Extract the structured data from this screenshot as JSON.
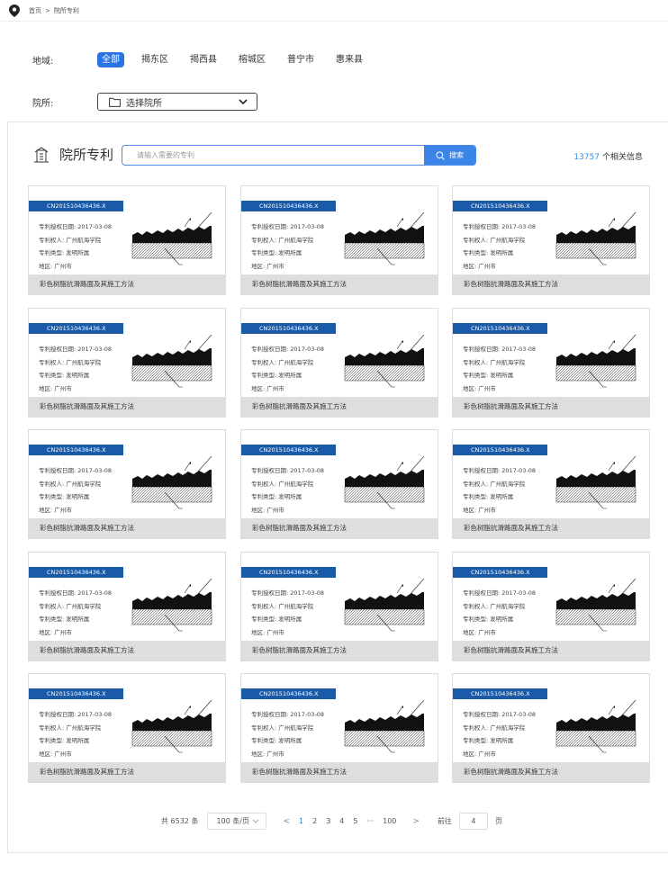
{
  "breadcrumb": {
    "home": "首页",
    "separator": ">",
    "current": "院所专利"
  },
  "filters": {
    "region_label": "地域:",
    "regions": [
      "全部",
      "揭东区",
      "揭西县",
      "榕城区",
      "普宁市",
      "惠来县"
    ],
    "active_region": "全部",
    "institution_label": "院所:",
    "institution_placeholder": "选择院所"
  },
  "panel": {
    "title": "院所专利",
    "search_placeholder": "请输入需要的专利",
    "search_button": "搜索",
    "result_count": "13757",
    "result_suffix": "个相关信息"
  },
  "field_labels": {
    "date": "专利授权日期:",
    "owner": "专利权人:",
    "type": "专利类型:",
    "region": "地区:"
  },
  "patents": [
    {
      "number": "CN201510436436.X",
      "date": "2017-03-08",
      "owner": "广州航海学院",
      "type": "发明所属",
      "region": "广州市",
      "title": "彩色树脂抗滑路面及其施工方法"
    },
    {
      "number": "CN201510436436.X",
      "date": "2017-03-08",
      "owner": "广州航海学院",
      "type": "发明所属",
      "region": "广州市",
      "title": "彩色树脂抗滑路面及其施工方法"
    },
    {
      "number": "CN201510436436.X",
      "date": "2017-03-08",
      "owner": "广州航海学院",
      "type": "发明所属",
      "region": "广州市",
      "title": "彩色树脂抗滑路面及其施工方法"
    },
    {
      "number": "CN201510436436.X",
      "date": "2017-03-08",
      "owner": "广州航海学院",
      "type": "发明所属",
      "region": "广州市",
      "title": "彩色树脂抗滑路面及其施工方法"
    },
    {
      "number": "CN201510436436.X",
      "date": "2017-03-08",
      "owner": "广州航海学院",
      "type": "发明所属",
      "region": "广州市",
      "title": "彩色树脂抗滑路面及其施工方法"
    },
    {
      "number": "CN201510436436.X",
      "date": "2017-03-08",
      "owner": "广州航海学院",
      "type": "发明所属",
      "region": "广州市",
      "title": "彩色树脂抗滑路面及其施工方法"
    },
    {
      "number": "CN201510436436.X",
      "date": "2017-03-08",
      "owner": "广州航海学院",
      "type": "发明所属",
      "region": "广州市",
      "title": "彩色树脂抗滑路面及其施工方法"
    },
    {
      "number": "CN201510436436.X",
      "date": "2017-03-08",
      "owner": "广州航海学院",
      "type": "发明所属",
      "region": "广州市",
      "title": "彩色树脂抗滑路面及其施工方法"
    },
    {
      "number": "CN201510436436.X",
      "date": "2017-03-08",
      "owner": "广州航海学院",
      "type": "发明所属",
      "region": "广州市",
      "title": "彩色树脂抗滑路面及其施工方法"
    },
    {
      "number": "CN201510436436.X",
      "date": "2017-03-08",
      "owner": "广州航海学院",
      "type": "发明所属",
      "region": "广州市",
      "title": "彩色树脂抗滑路面及其施工方法"
    },
    {
      "number": "CN201510436436.X",
      "date": "2017-03-08",
      "owner": "广州航海学院",
      "type": "发明所属",
      "region": "广州市",
      "title": "彩色树脂抗滑路面及其施工方法"
    },
    {
      "number": "CN201510436436.X",
      "date": "2017-03-08",
      "owner": "广州航海学院",
      "type": "发明所属",
      "region": "广州市",
      "title": "彩色树脂抗滑路面及其施工方法"
    },
    {
      "number": "CN201510436436.X",
      "date": "2017-03-08",
      "owner": "广州航海学院",
      "type": "发明所属",
      "region": "广州市",
      "title": "彩色树脂抗滑路面及其施工方法"
    },
    {
      "number": "CN201510436436.X",
      "date": "2017-03-08",
      "owner": "广州航海学院",
      "type": "发明所属",
      "region": "广州市",
      "title": "彩色树脂抗滑路面及其施工方法"
    },
    {
      "number": "CN201510436436.X",
      "date": "2017-03-08",
      "owner": "广州航海学院",
      "type": "发明所属",
      "region": "广州市",
      "title": "彩色树脂抗滑路面及其施工方法"
    }
  ],
  "pagination": {
    "total_text": "共 6532 条",
    "page_size": "100 条/页",
    "prev": "<",
    "pages": [
      "1",
      "2",
      "3",
      "4",
      "5",
      "···",
      "100"
    ],
    "current_page": "1",
    "next": ">",
    "goto_label": "前往",
    "goto_value": "4",
    "goto_unit": "页"
  },
  "colors": {
    "accent": "#2b73e0",
    "patent_tag": "#1b5aa8",
    "count_number": "#3a8ee6",
    "card_footer": "#dedede"
  },
  "icons": [
    "location-pin-icon",
    "folder-icon",
    "chevron-down-icon",
    "building-icon",
    "search-icon",
    "patent-diagram-image"
  ]
}
